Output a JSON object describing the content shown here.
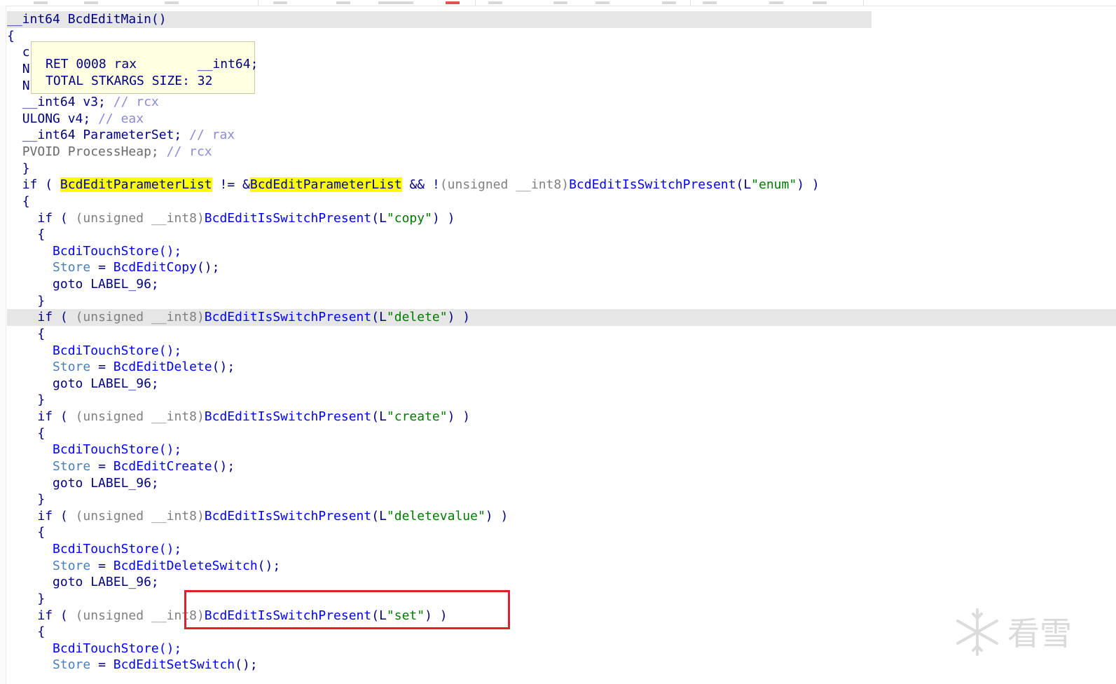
{
  "function_signature": "__int64 BcdEditMain()",
  "tooltip": {
    "line1": "RET 0008 rax        __int64;",
    "line2": "TOTAL STKARGS SIZE: 32"
  },
  "decl": {
    "hidden1": "cl",
    "hidden2": "N",
    "hidden3": "N",
    "v3_type": "__int64 v3;",
    "v3_cmt": "// rcx",
    "v4_type": "ULONG v4;",
    "v4_cmt": "// eax",
    "ps_type": "__int64 ParameterSet;",
    "ps_cmt": "// rax",
    "ph_type": "PVOID ProcessHeap;",
    "ph_cmt": "// rcx"
  },
  "condition": {
    "kw": "if",
    "var": "BcdEditParameterList",
    "op": "!=",
    "amp": "&",
    "and": "&&",
    "not": "!",
    "cast": "(unsigned __int8)",
    "fn": "BcdEditIsSwitchPresent",
    "arg": "\"enum\""
  },
  "blocks": [
    {
      "arg": "\"copy\"",
      "call": "BcdEditCopy"
    },
    {
      "arg": "\"delete\"",
      "call": "BcdEditDelete"
    },
    {
      "arg": "\"create\"",
      "call": "BcdEditCreate"
    },
    {
      "arg": "\"deletevalue\"",
      "call": "BcdEditDeleteSwitch"
    },
    {
      "arg": "\"set\"",
      "call": "BcdEditSetSwitch"
    }
  ],
  "common": {
    "if": "if",
    "cast": "(unsigned __int8)",
    "fn": "BcdEditIsSwitchPresent",
    "L": "L",
    "touch": "BcdiTouchStore();",
    "store": "Store",
    "eq": "=",
    "goto": "goto LABEL_96;",
    "open": "{",
    "close": "}"
  },
  "watermark": {
    "text": "看雪",
    "icon": "snowflake-icon"
  },
  "colors": {
    "keyword": "#000080",
    "function": "#0000ff",
    "string": "#007a00",
    "cast": "#808080",
    "highlight": "#ffff00",
    "annotation_box": "#e0202a"
  }
}
